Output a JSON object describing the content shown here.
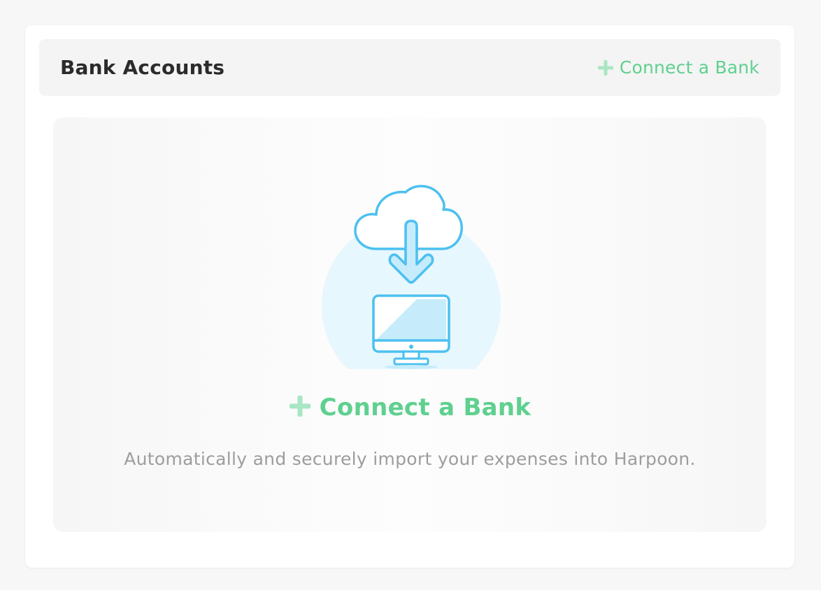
{
  "card": {
    "title": "Bank Accounts",
    "header_action": {
      "icon": "plus-icon",
      "label": "Connect a Bank"
    }
  },
  "empty_state": {
    "illustration": "cloud-download-to-computer-icon",
    "cta": {
      "icon": "plus-icon",
      "label": "Connect a Bank"
    },
    "description": "Automatically and securely import your expenses into Harpoon."
  },
  "colors": {
    "accent_green": "#5fd08f",
    "plus_green": "#a8e6c4",
    "illustration_blue": "#4cc0f0",
    "illustration_fill": "#c6ecfb",
    "circle_bg": "#e6f7fd"
  }
}
